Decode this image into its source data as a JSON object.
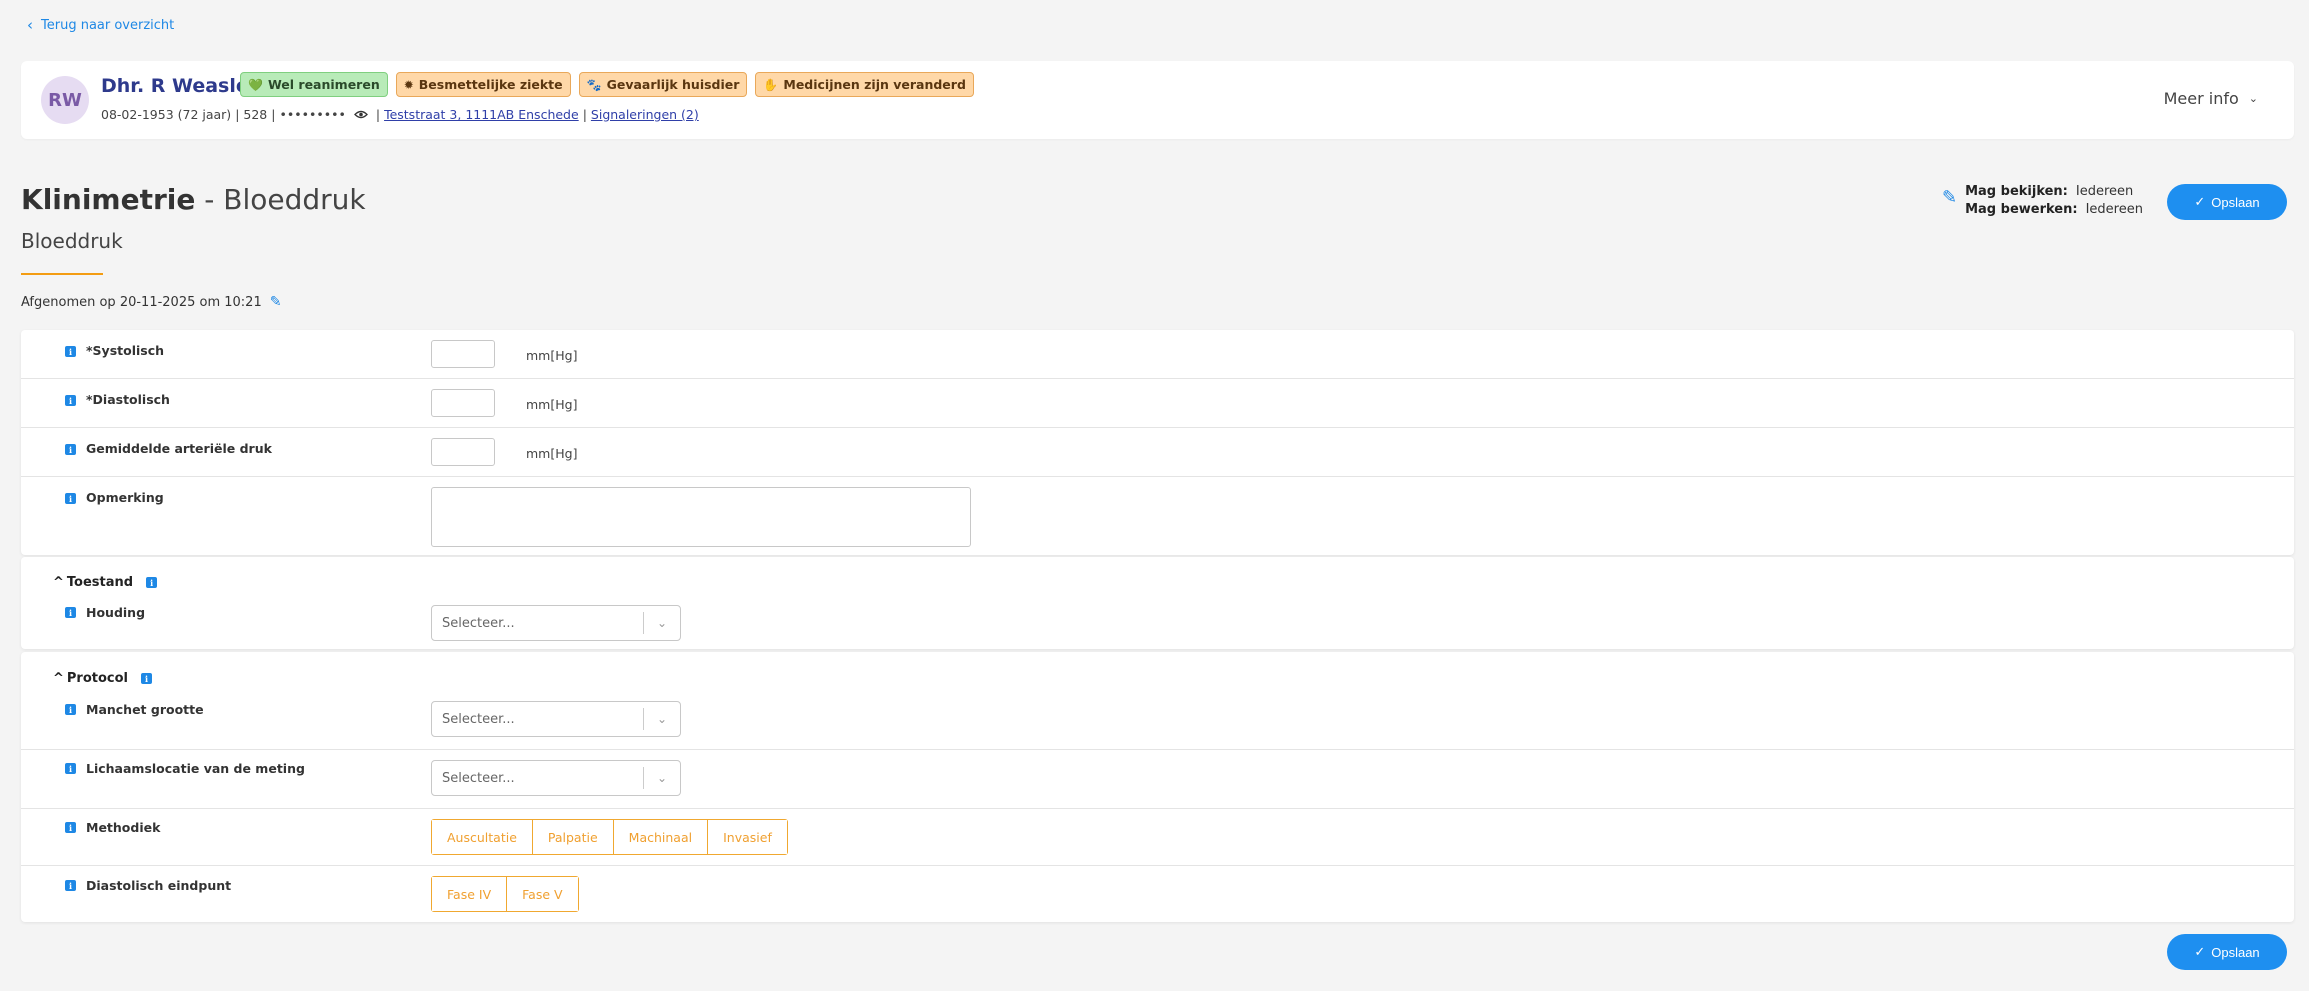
{
  "nav": {
    "back_label": "Terug naar overzicht"
  },
  "patient": {
    "initials": "RW",
    "name": "Dhr. R Weasley",
    "dob": "08-02-1953 (72 jaar)",
    "id": "528",
    "masked": "•••••••••",
    "address": "Teststraat 3, 1111AB Enschede",
    "signals": "Signaleringen (2)",
    "badges": [
      {
        "label": "Wel reanimeren",
        "icon": "heart-icon",
        "color": "#b8ebb8"
      },
      {
        "label": "Besmettelijke ziekte",
        "icon": "virus-icon",
        "color": "#ffd8a8"
      },
      {
        "label": "Gevaarlijk huisdier",
        "icon": "paw-icon",
        "color": "#ffd8a8"
      },
      {
        "label": "Medicijnen zijn veranderd",
        "icon": "hand-icon",
        "color": "#ffd8a8"
      }
    ],
    "more_info": "Meer info"
  },
  "header": {
    "title_bold": "Klinimetrie",
    "title_rest": " - Bloeddruk",
    "subtitle": "Bloeddruk",
    "view_label": "Mag bekijken:",
    "view_value": "Iedereen",
    "edit_label": "Mag bewerken:",
    "edit_value": "Iedereen",
    "save_label": "Opslaan",
    "taken_on": "Afgenomen op 20-11-2025 om 10:21"
  },
  "fields": {
    "systolic": {
      "label": "*Systolisch",
      "unit": "mm[Hg]",
      "value": ""
    },
    "diastolic": {
      "label": "*Diastolisch",
      "unit": "mm[Hg]",
      "value": ""
    },
    "map": {
      "label": "Gemiddelde arteriële druk",
      "unit": "mm[Hg]",
      "value": ""
    },
    "remark": {
      "label": "Opmerking",
      "value": ""
    }
  },
  "toestand": {
    "title": "Toestand",
    "houding": {
      "label": "Houding",
      "placeholder": "Selecteer..."
    }
  },
  "protocol": {
    "title": "Protocol",
    "cuff": {
      "label": "Manchet grootte",
      "placeholder": "Selecteer..."
    },
    "location": {
      "label": "Lichaamslocatie van de meting",
      "placeholder": "Selecteer..."
    },
    "method": {
      "label": "Methodiek",
      "options": [
        "Auscultatie",
        "Palpatie",
        "Machinaal",
        "Invasief"
      ]
    },
    "endpoint": {
      "label": "Diastolisch eindpunt",
      "options": [
        "Fase IV",
        "Fase V"
      ]
    }
  },
  "colors": {
    "accent": "#1e8ff0",
    "orange": "#f0a830",
    "underline": "#f39c12"
  }
}
